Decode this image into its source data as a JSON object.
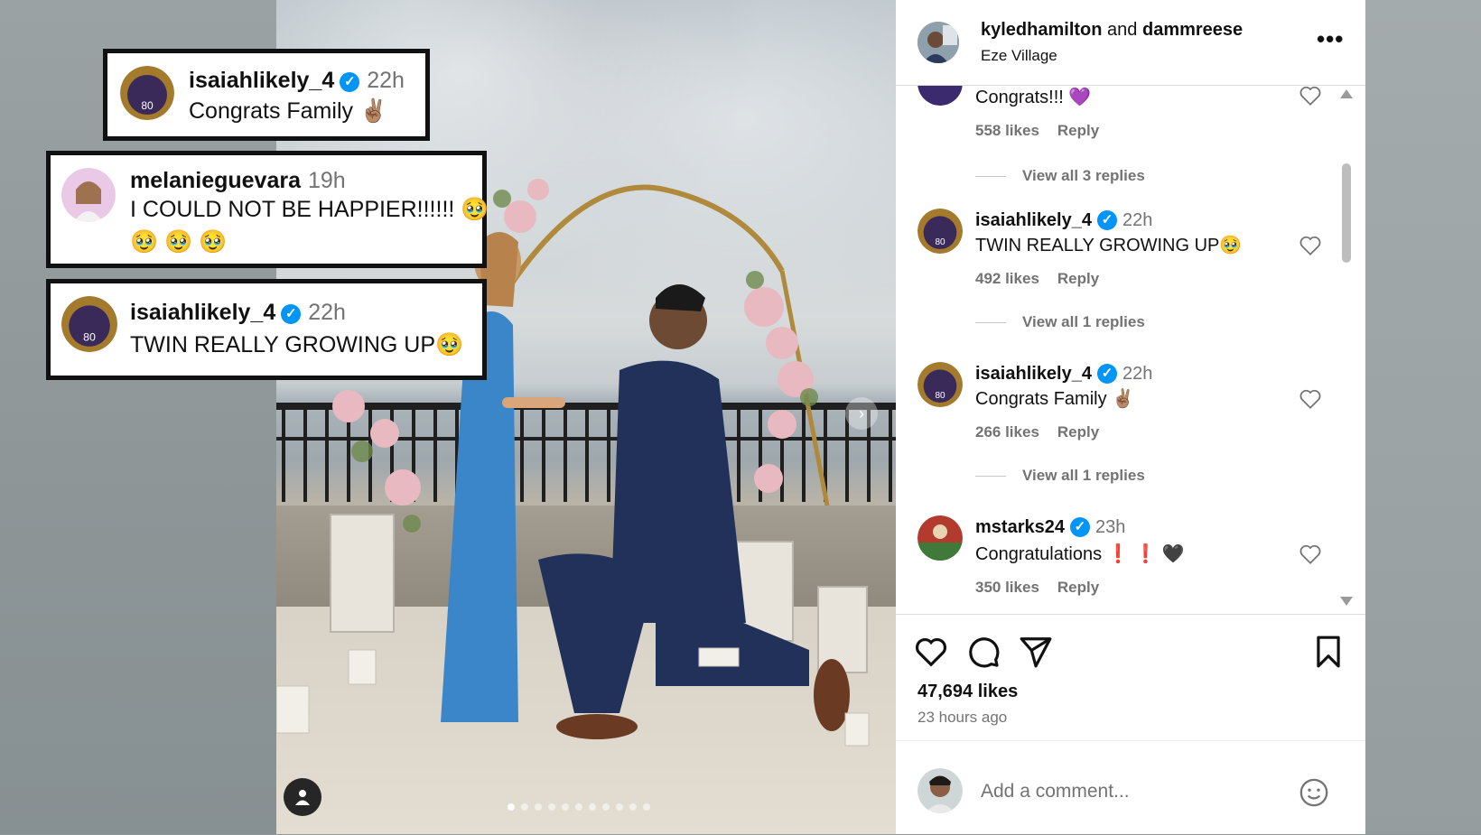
{
  "post": {
    "author1": "kyledhamilton",
    "joiner": "and",
    "author2": "dammreese",
    "location": "Eze Village",
    "more_label": "•••",
    "likes": "47,694 likes",
    "time_ago": "23 hours ago",
    "add_comment_placeholder": "Add a comment...",
    "carousel_count": 11,
    "carousel_active": 0
  },
  "callouts": [
    {
      "user": "isaiahlikely_4",
      "time": "22h",
      "text": "Congrats Family ✌🏽"
    },
    {
      "user": "melanieguevara",
      "time": "19h",
      "text": "I COULD NOT BE HAPPIER!!!!!! 🥹",
      "text2": "🥹 🥹 🥹"
    },
    {
      "user": "isaiahlikely_4",
      "time": "22h",
      "text": "TWIN REALLY GROWING UP🥹"
    }
  ],
  "comments": [
    {
      "user": "",
      "time": "",
      "text": "Congrats!!! 💜",
      "likes": "558 likes",
      "reply": "Reply",
      "replies": "View all 3 replies"
    },
    {
      "user": "isaiahlikely_4",
      "time": "22h",
      "text": "TWIN REALLY GROWING UP🥹",
      "likes": "492 likes",
      "reply": "Reply",
      "replies": "View all 1 replies"
    },
    {
      "user": "isaiahlikely_4",
      "time": "22h",
      "text": "Congrats Family ✌🏽",
      "likes": "266 likes",
      "reply": "Reply",
      "replies": "View all 1 replies"
    },
    {
      "user": "mstarks24",
      "time": "23h",
      "text": "Congratulations ❗ ❗ 🖤",
      "likes": "350 likes",
      "reply": "Reply",
      "replies": ""
    }
  ],
  "icons": {
    "like": "heart-icon",
    "comment": "comment-icon",
    "share": "send-icon",
    "save": "bookmark-icon",
    "emoji": "smiley-icon"
  },
  "colors": {
    "verified": "#0095f6",
    "muted_text": "#737373",
    "border": "#dbdbdb"
  }
}
